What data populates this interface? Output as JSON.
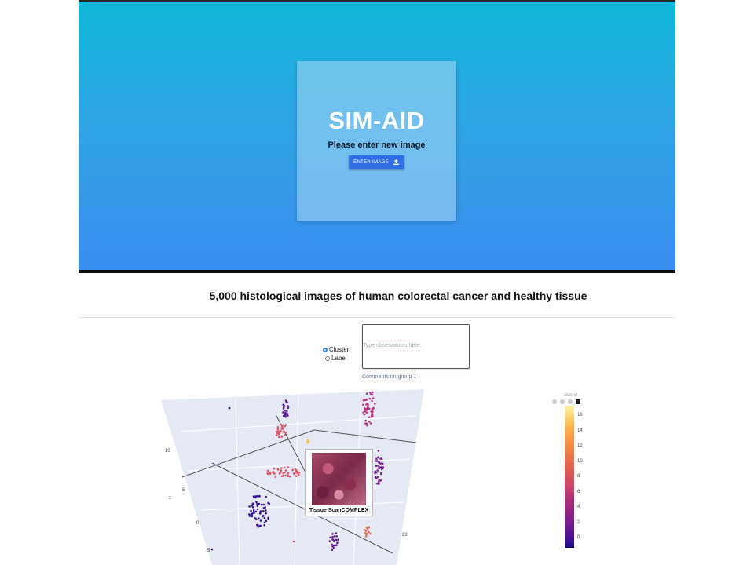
{
  "hero": {
    "app_title": "SIM-AID",
    "subtitle": "Please enter new image",
    "enter_button_label": "ENTER IMAGE",
    "upload_icon": "upload-icon",
    "gradient_top": "#10b7d8",
    "gradient_bottom": "#3a8ef0",
    "button_color": "#2f6fe3"
  },
  "dataset": {
    "title": "5,000 histological images of human colorectal cancer and healthy tissue"
  },
  "controls": {
    "radio_options": [
      "Cluster",
      "Label"
    ],
    "selected": "Cluster",
    "observations_placeholder": "Type observations here.",
    "comments_label": "Comments on group 1"
  },
  "plot": {
    "hover_caption": "Tissue ScanCOMPLEX",
    "axis_ticks": [
      "10",
      "5",
      "0",
      "-5"
    ],
    "axis_letter": "z",
    "far_axis_tick": "22",
    "colorbar_title": "cluster",
    "colorbar_ticks": [
      "16",
      "14",
      "12",
      "10",
      "8",
      "6",
      "4",
      "2",
      "0"
    ]
  }
}
